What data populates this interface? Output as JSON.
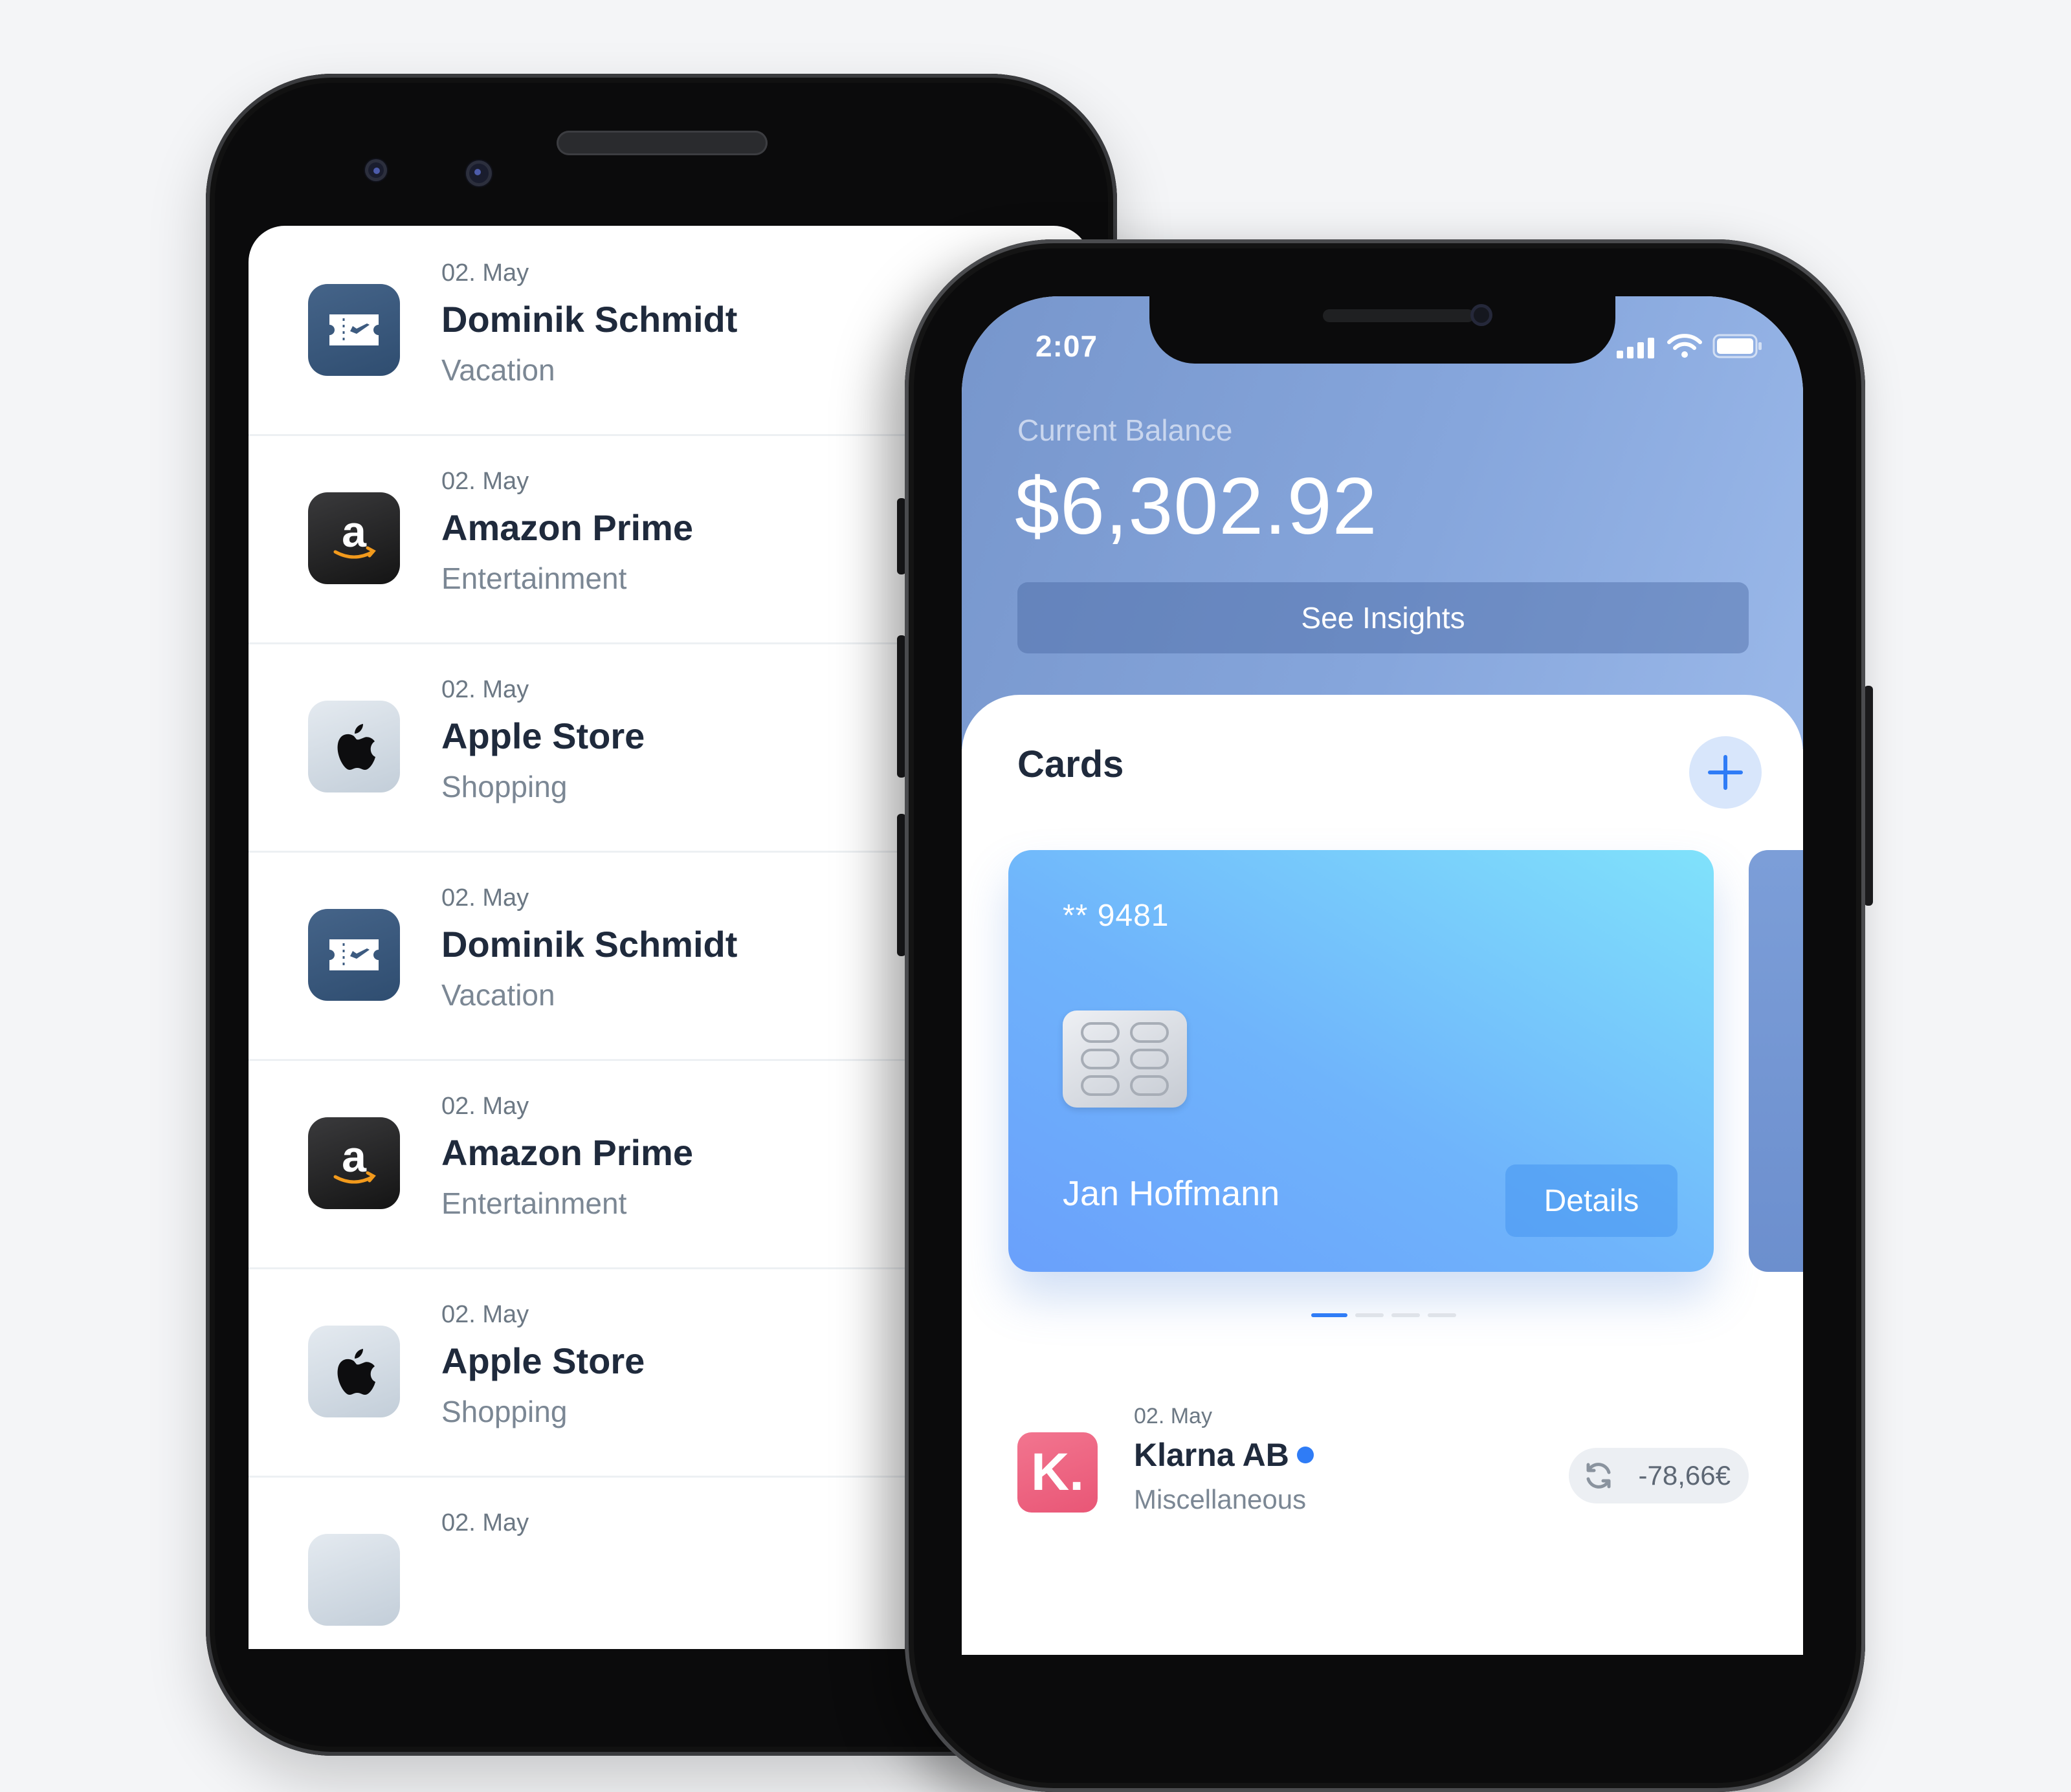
{
  "transactions": [
    {
      "date": "02. May",
      "title": "Dominik Schmidt",
      "category": "Vacation",
      "icon": "ticket-icon"
    },
    {
      "date": "02. May",
      "title": "Amazon Prime",
      "category": "Entertainment",
      "icon": "amazon-logo-icon"
    },
    {
      "date": "02. May",
      "title": "Apple Store",
      "category": "Shopping",
      "icon": "apple-logo-icon"
    },
    {
      "date": "02. May",
      "title": "Dominik Schmidt",
      "category": "Vacation",
      "icon": "ticket-icon"
    },
    {
      "date": "02. May",
      "title": "Amazon Prime",
      "category": "Entertainment",
      "icon": "amazon-logo-icon"
    },
    {
      "date": "02. May",
      "title": "Apple Store",
      "category": "Shopping",
      "icon": "apple-logo-icon"
    },
    {
      "date": "02. May",
      "title": "",
      "category": "",
      "icon": "apple-logo-icon"
    }
  ],
  "status_bar": {
    "time": "2:07",
    "icons": [
      "signal-icon",
      "wifi-icon",
      "battery-icon"
    ]
  },
  "balance": {
    "label": "Current Balance",
    "value": "$6,302.92",
    "insights_button": "See Insights"
  },
  "cards": {
    "heading": "Cards",
    "add_icon": "plus-icon",
    "active_card": {
      "number": "** 9481",
      "holder": "Jan Hoffmann",
      "details_button": "Details"
    },
    "page_count": 4,
    "active_page": 1,
    "colors": {
      "card_start": "#6aa0fb",
      "card_end": "#80e2fb",
      "accent": "#2f7cf6"
    }
  },
  "latest_transaction": {
    "logo_letter": "K.",
    "date": "02. May",
    "title": "Klarna AB",
    "category": "Miscellaneous",
    "amount": "-78,66€",
    "amount_icon": "refresh-icon"
  }
}
